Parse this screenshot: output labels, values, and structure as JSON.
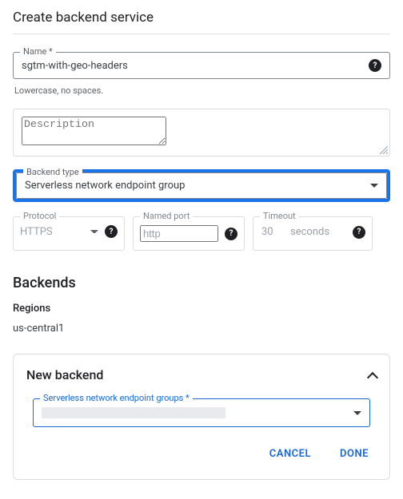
{
  "header": {
    "title": "Create backend service"
  },
  "name_field": {
    "label": "Name *",
    "value": "sgtm-with-geo-headers",
    "hint": "Lowercase, no spaces."
  },
  "description_field": {
    "placeholder": "Description"
  },
  "backend_type": {
    "label": "Backend type",
    "selected": "Serverless network endpoint group"
  },
  "protocol": {
    "label": "Protocol",
    "value": "HTTPS"
  },
  "named_port": {
    "label": "Named port",
    "value": "http"
  },
  "timeout": {
    "label": "Timeout",
    "value": "30",
    "unit": "seconds"
  },
  "backends": {
    "heading": "Backends",
    "regions_label": "Regions",
    "region_value": "us-central1"
  },
  "new_backend": {
    "title": "New backend",
    "neg_label": "Serverless network endpoint groups *",
    "cancel": "CANCEL",
    "done": "DONE"
  }
}
